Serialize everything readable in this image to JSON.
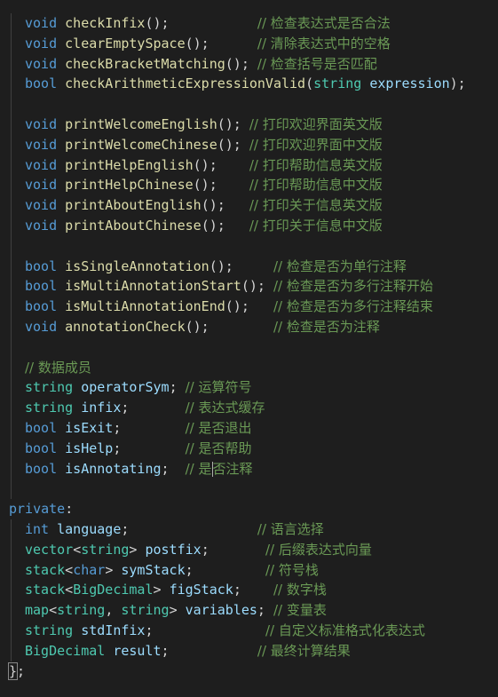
{
  "lines": [
    {
      "indent": true,
      "tokens": [
        [
          "kw",
          "void "
        ],
        [
          "fn",
          "checkInfix"
        ],
        [
          "punc",
          "();           "
        ],
        [
          "cmt",
          "// 检查表达式是否合法"
        ]
      ]
    },
    {
      "indent": true,
      "tokens": [
        [
          "kw",
          "void "
        ],
        [
          "fn",
          "clearEmptySpace"
        ],
        [
          "punc",
          "();      "
        ],
        [
          "cmt",
          "// 清除表达式中的空格"
        ]
      ]
    },
    {
      "indent": true,
      "tokens": [
        [
          "kw",
          "void "
        ],
        [
          "fn",
          "checkBracketMatching"
        ],
        [
          "punc",
          "(); "
        ],
        [
          "cmt",
          "// 检查括号是否匹配"
        ]
      ]
    },
    {
      "indent": true,
      "tokens": [
        [
          "kw",
          "bool "
        ],
        [
          "fn",
          "checkArithmeticExpressionValid"
        ],
        [
          "punc",
          "("
        ],
        [
          "type",
          "string "
        ],
        [
          "var",
          "expression"
        ],
        [
          "punc",
          ");"
        ]
      ]
    },
    {
      "indent": true,
      "tokens": []
    },
    {
      "indent": true,
      "tokens": [
        [
          "kw",
          "void "
        ],
        [
          "fn",
          "printWelcomeEnglish"
        ],
        [
          "punc",
          "(); "
        ],
        [
          "cmt",
          "// 打印欢迎界面英文版"
        ]
      ]
    },
    {
      "indent": true,
      "tokens": [
        [
          "kw",
          "void "
        ],
        [
          "fn",
          "printWelcomeChinese"
        ],
        [
          "punc",
          "(); "
        ],
        [
          "cmt",
          "// 打印欢迎界面中文版"
        ]
      ]
    },
    {
      "indent": true,
      "tokens": [
        [
          "kw",
          "void "
        ],
        [
          "fn",
          "printHelpEnglish"
        ],
        [
          "punc",
          "();    "
        ],
        [
          "cmt",
          "// 打印帮助信息英文版"
        ]
      ]
    },
    {
      "indent": true,
      "tokens": [
        [
          "kw",
          "void "
        ],
        [
          "fn",
          "printHelpChinese"
        ],
        [
          "punc",
          "();    "
        ],
        [
          "cmt",
          "// 打印帮助信息中文版"
        ]
      ]
    },
    {
      "indent": true,
      "tokens": [
        [
          "kw",
          "void "
        ],
        [
          "fn",
          "printAboutEnglish"
        ],
        [
          "punc",
          "();   "
        ],
        [
          "cmt",
          "// 打印关于信息英文版"
        ]
      ]
    },
    {
      "indent": true,
      "tokens": [
        [
          "kw",
          "void "
        ],
        [
          "fn",
          "printAboutChinese"
        ],
        [
          "punc",
          "();   "
        ],
        [
          "cmt",
          "// 打印关于信息中文版"
        ]
      ]
    },
    {
      "indent": true,
      "tokens": []
    },
    {
      "indent": true,
      "tokens": [
        [
          "kw",
          "bool "
        ],
        [
          "fn",
          "isSingleAnnotation"
        ],
        [
          "punc",
          "();     "
        ],
        [
          "cmt",
          "// 检查是否为单行注释"
        ]
      ]
    },
    {
      "indent": true,
      "tokens": [
        [
          "kw",
          "bool "
        ],
        [
          "fn",
          "isMultiAnnotationStart"
        ],
        [
          "punc",
          "(); "
        ],
        [
          "cmt",
          "// 检查是否为多行注释开始"
        ]
      ]
    },
    {
      "indent": true,
      "tokens": [
        [
          "kw",
          "bool "
        ],
        [
          "fn",
          "isMultiAnnotationEnd"
        ],
        [
          "punc",
          "();   "
        ],
        [
          "cmt",
          "// 检查是否为多行注释结束"
        ]
      ]
    },
    {
      "indent": true,
      "tokens": [
        [
          "kw",
          "void "
        ],
        [
          "fn",
          "annotationCheck"
        ],
        [
          "punc",
          "();        "
        ],
        [
          "cmt",
          "// 检查是否为注释"
        ]
      ]
    },
    {
      "indent": true,
      "tokens": []
    },
    {
      "indent": true,
      "tokens": [
        [
          "cmt",
          "// 数据成员"
        ]
      ]
    },
    {
      "indent": true,
      "tokens": [
        [
          "type",
          "string "
        ],
        [
          "var",
          "operatorSym"
        ],
        [
          "punc",
          "; "
        ],
        [
          "cmt",
          "// 运算符号"
        ]
      ]
    },
    {
      "indent": true,
      "tokens": [
        [
          "type",
          "string "
        ],
        [
          "var",
          "infix"
        ],
        [
          "punc",
          ";       "
        ],
        [
          "cmt",
          "// 表达式缓存"
        ]
      ]
    },
    {
      "indent": true,
      "tokens": [
        [
          "kw",
          "bool "
        ],
        [
          "var",
          "isExit"
        ],
        [
          "punc",
          ";        "
        ],
        [
          "cmt",
          "// 是否退出"
        ]
      ]
    },
    {
      "indent": true,
      "tokens": [
        [
          "kw",
          "bool "
        ],
        [
          "var",
          "isHelp"
        ],
        [
          "punc",
          ";        "
        ],
        [
          "cmt",
          "// 是否帮助"
        ]
      ]
    },
    {
      "indent": true,
      "cursor": true,
      "tokens": [
        [
          "kw",
          "bool "
        ],
        [
          "var",
          "isAnnotating"
        ],
        [
          "punc",
          ";  "
        ],
        [
          "cmt",
          "// 是"
        ],
        [
          "cursor",
          ""
        ],
        [
          "cmt",
          "否注释"
        ]
      ]
    },
    {
      "indent": true,
      "tokens": []
    },
    {
      "indent": false,
      "tokens": [
        [
          "kw",
          "private"
        ],
        [
          "punc",
          ":"
        ]
      ]
    },
    {
      "indent": true,
      "tokens": [
        [
          "kw",
          "int "
        ],
        [
          "var",
          "language"
        ],
        [
          "punc",
          ";                "
        ],
        [
          "cmt",
          "// 语言选择"
        ]
      ]
    },
    {
      "indent": true,
      "tokens": [
        [
          "type",
          "vector"
        ],
        [
          "punc",
          "<"
        ],
        [
          "type",
          "string"
        ],
        [
          "punc",
          "> "
        ],
        [
          "var",
          "postfix"
        ],
        [
          "punc",
          ";       "
        ],
        [
          "cmt",
          "// 后缀表达式向量"
        ]
      ]
    },
    {
      "indent": true,
      "tokens": [
        [
          "type",
          "stack"
        ],
        [
          "punc",
          "<"
        ],
        [
          "kw",
          "char"
        ],
        [
          "punc",
          "> "
        ],
        [
          "var",
          "symStack"
        ],
        [
          "punc",
          ";         "
        ],
        [
          "cmt",
          "// 符号栈"
        ]
      ]
    },
    {
      "indent": true,
      "tokens": [
        [
          "type",
          "stack"
        ],
        [
          "punc",
          "<"
        ],
        [
          "type",
          "BigDecimal"
        ],
        [
          "punc",
          "> "
        ],
        [
          "var",
          "figStack"
        ],
        [
          "punc",
          ";    "
        ],
        [
          "cmt",
          "// 数字栈"
        ]
      ]
    },
    {
      "indent": true,
      "tokens": [
        [
          "type",
          "map"
        ],
        [
          "punc",
          "<"
        ],
        [
          "type",
          "string"
        ],
        [
          "punc",
          ", "
        ],
        [
          "type",
          "string"
        ],
        [
          "punc",
          "> "
        ],
        [
          "var",
          "variables"
        ],
        [
          "punc",
          "; "
        ],
        [
          "cmt",
          "// 变量表"
        ]
      ]
    },
    {
      "indent": true,
      "tokens": [
        [
          "type",
          "string "
        ],
        [
          "var",
          "stdInfix"
        ],
        [
          "punc",
          ";              "
        ],
        [
          "cmt",
          "// 自定义标准格式化表达式"
        ]
      ]
    },
    {
      "indent": true,
      "tokens": [
        [
          "type",
          "BigDecimal "
        ],
        [
          "var",
          "result"
        ],
        [
          "punc",
          ";           "
        ],
        [
          "cmt",
          "// 最终计算结果"
        ]
      ]
    },
    {
      "indent": false,
      "tokens": [
        [
          "brace",
          "}"
        ],
        [
          "punc",
          ";"
        ]
      ]
    }
  ]
}
